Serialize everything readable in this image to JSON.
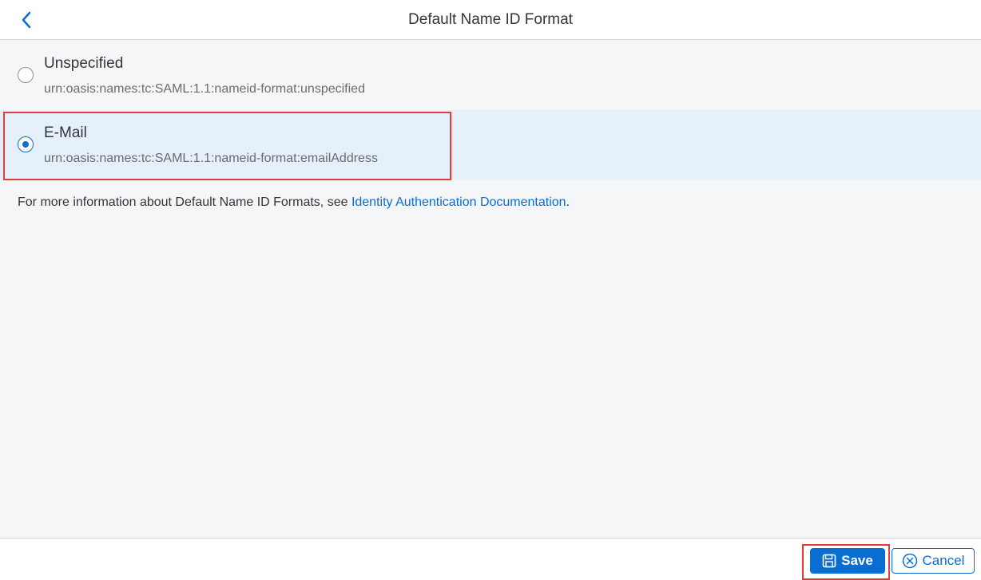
{
  "header": {
    "title": "Default Name ID Format",
    "back_icon": "chevron-left-icon"
  },
  "options": [
    {
      "title": "Unspecified",
      "description": "urn:oasis:names:tc:SAML:1.1:nameid-format:unspecified",
      "selected": false
    },
    {
      "title": "E-Mail",
      "description": "urn:oasis:names:tc:SAML:1.1:nameid-format:emailAddress",
      "selected": true
    }
  ],
  "info": {
    "prefix": "For more information about Default Name ID Formats, see ",
    "link_text": "Identity Authentication Documentation",
    "suffix": "."
  },
  "footer": {
    "save_label": "Save",
    "cancel_label": "Cancel"
  },
  "colors": {
    "accent": "#0a6ed1",
    "highlight": "#e03c3c",
    "selected_bg": "#e5f0fa"
  }
}
